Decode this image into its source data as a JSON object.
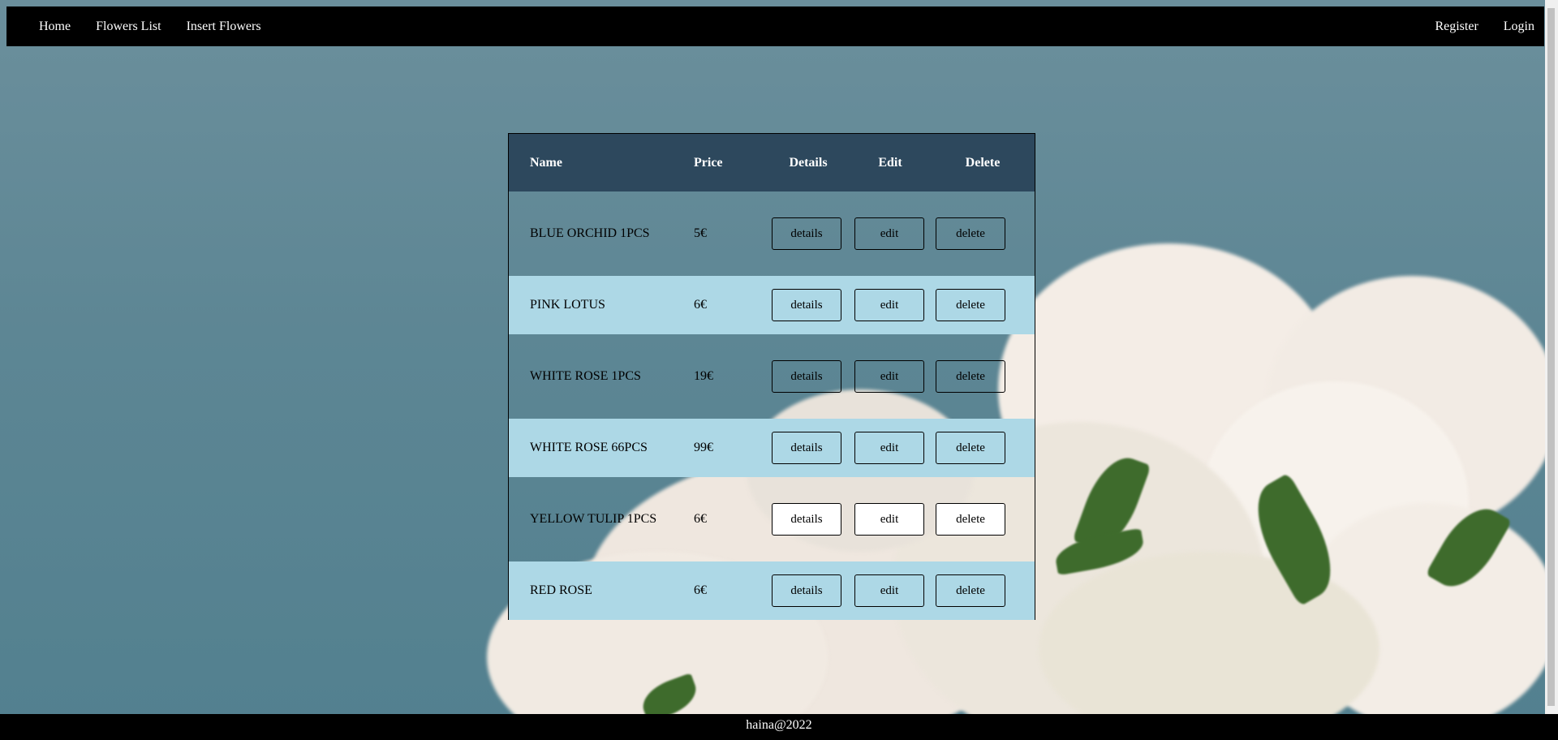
{
  "nav": {
    "left": [
      "Home",
      "Flowers List",
      "Insert Flowers"
    ],
    "right": [
      "Register",
      "Login"
    ]
  },
  "table": {
    "headers": {
      "name": "Name",
      "price": "Price",
      "details": "Details",
      "edit": "Edit",
      "delete": "Delete"
    },
    "rows": [
      {
        "name": "BLUE ORCHID 1PCS",
        "price": "5€"
      },
      {
        "name": "PINK LOTUS",
        "price": "6€"
      },
      {
        "name": "WHITE ROSE 1PCS",
        "price": "19€"
      },
      {
        "name": "WHITE ROSE 66PCS",
        "price": "99€"
      },
      {
        "name": "YELLOW TULIP 1PCS",
        "price": "6€"
      },
      {
        "name": "RED ROSE",
        "price": "6€"
      }
    ],
    "buttons": {
      "details": "details",
      "edit": "edit",
      "delete": "delete"
    }
  },
  "footer": {
    "text": "haina@2022"
  },
  "colors": {
    "navbar": "#000000",
    "table_header": "#2d485d",
    "row_light": "#add8e6",
    "background": "#5d8694"
  }
}
